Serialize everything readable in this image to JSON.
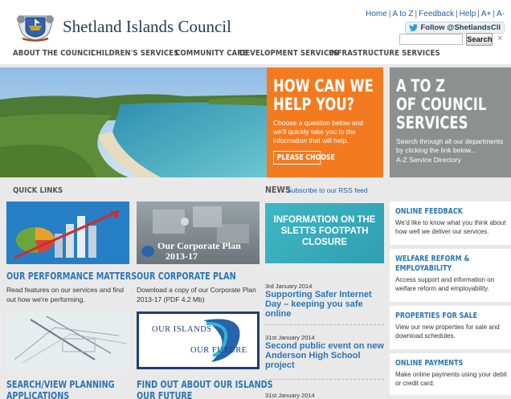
{
  "header": {
    "council_name": "Shetland Islands Council",
    "toplinks": [
      "Home",
      "A to Z",
      "Feedback",
      "Help",
      "A+",
      "A-"
    ],
    "twitter_label": "Follow @ShetlandsCll",
    "search_placeholder": "",
    "search_button": "Search",
    "search_clear": "×"
  },
  "nav": {
    "items": [
      "ABOUT THE COUNCIL",
      "CHILDREN'S SERVICES",
      "COMMUNITY CARE",
      "DEVELOPMENT SERVICES",
      "INFRASTRUCTURE SERVICES"
    ]
  },
  "help": {
    "title_line1": "HOW CAN WE",
    "title_line2": "HELP YOU?",
    "text": "Choose a question below and we'll quickly take you to the information that will help.",
    "button": "PLEASE CHOOSE"
  },
  "az": {
    "title_line1": "A TO Z",
    "title_line2": "OF COUNCIL",
    "title_line3": "SERVICES",
    "text": "Search through all our departments by clicking the link below...",
    "link": "A-Z Service Directory"
  },
  "quick_links": {
    "heading": "QUICK LINKS",
    "cards": [
      {
        "title": "OUR PERFORMANCE MATTERS",
        "text": "Read features on our services and find out how we're performing."
      },
      {
        "title": "OUR CORPORATE PLAN",
        "text": "Download a copy of our Corporate Plan 2013-17 (PDF 4.2 Mb)",
        "image_text_1": "Our Corporate Plan",
        "image_text_2": "2013-17"
      },
      {
        "title": "SEARCH/VIEW PLANNING",
        "title2": "APPLICATIONS"
      },
      {
        "title": "FIND OUT ABOUT OUR ISLANDS",
        "title2": "OUR FUTURE",
        "image_text_1": "OUR ISLANDS",
        "image_text_2": "OUR FUTURE"
      }
    ]
  },
  "news": {
    "heading": "NEWS",
    "rss": "Subscribe to our RSS feed",
    "banner": "INFORMATION ON THE SLETTS FOOTPATH CLOSURE",
    "items": [
      {
        "date": "3rd January 2014",
        "title": "Supporting Safer Internet Day – keeping you safe online"
      },
      {
        "date": "31st January 2014",
        "title": "Second public event on new Anderson High School project"
      },
      {
        "date": "31st January 2014",
        "title": ""
      }
    ]
  },
  "sidebar": {
    "items": [
      {
        "title": "ONLINE FEEDBACK",
        "text": "We'd like to know what you think about how well we deliver our services."
      },
      {
        "title": "WELFARE REFORM &",
        "title2": "EMPLOYABILITY",
        "text": "Access support and information on welfare reform and employability."
      },
      {
        "title": "PROPERTIES FOR SALE",
        "text": "View our new properties for sale and download schedules."
      },
      {
        "title": "ONLINE PAYMENTS",
        "text": "Make online payments using your debit or credit card."
      }
    ]
  }
}
